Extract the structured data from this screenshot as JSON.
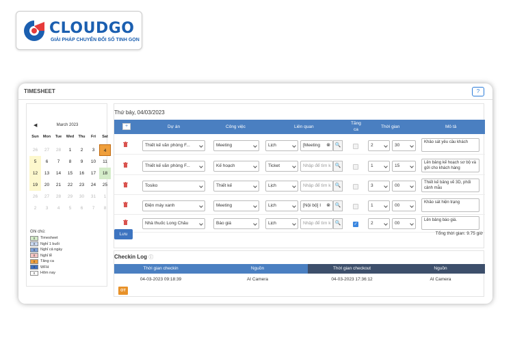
{
  "brand": {
    "name": "CLOUDGO",
    "tagline": "GIẢI PHÁP CHUYỂN ĐỔI SỐ TINH GỌN"
  },
  "header": {
    "title": "TIMESHEET",
    "help_label": "?"
  },
  "calendar": {
    "nav_prev": "◀",
    "month_label": "March 2023",
    "weekdays": [
      "Sun",
      "Mon",
      "Tue",
      "Wed",
      "Thu",
      "Fri",
      "Sat"
    ],
    "weeks": [
      [
        "26",
        "27",
        "28",
        "1",
        "2",
        "3",
        "4"
      ],
      [
        "5",
        "6",
        "7",
        "8",
        "9",
        "10",
        "11"
      ],
      [
        "12",
        "13",
        "14",
        "15",
        "16",
        "17",
        "18"
      ],
      [
        "19",
        "20",
        "21",
        "22",
        "23",
        "24",
        "25"
      ],
      [
        "26",
        "27",
        "28",
        "29",
        "30",
        "31",
        "1"
      ],
      [
        "2",
        "3",
        "4",
        "5",
        "6",
        "7",
        "8"
      ]
    ]
  },
  "legend": {
    "title": "Ghi chú:",
    "items": [
      {
        "label": "Timesheet",
        "color": "#d4ecc9",
        "mark": "x"
      },
      {
        "label": "Nghỉ 1 buổi",
        "color": "#c9d7f0",
        "mark": "x"
      },
      {
        "label": "Nghỉ cả ngày",
        "color": "#7e9fd6",
        "mark": "x"
      },
      {
        "label": "Nghỉ lễ",
        "color": "#f4c4c4",
        "mark": "x"
      },
      {
        "label": "Tăng ca",
        "color": "#ef9f3c",
        "mark": "x"
      },
      {
        "label": "WFH",
        "color": "#3c6fc0",
        "mark": "x"
      },
      {
        "label": "Hôm nay",
        "color": "#ffffff",
        "mark": "x"
      }
    ]
  },
  "timesheet": {
    "day_title": "Thứ bảy, 04/03/2023",
    "add_label": "+",
    "columns": {
      "project": "Dự án",
      "task": "Công việc",
      "related": "Liên quan",
      "overtime_1": "Tăng",
      "overtime_2": "ca",
      "time": "Thời gian",
      "description": "Mô tả"
    },
    "rows": [
      {
        "project": "Thiết kế văn phòng F...",
        "task": "Meeting",
        "rel_type": "Lịch",
        "rel_value": "[Meeting",
        "rel_filled": true,
        "clear": "⊗",
        "overtime": false,
        "hours": "2",
        "minutes": "30",
        "description": "Khảo sát yêu cầu khách"
      },
      {
        "project": "Thiết kế văn phòng F...",
        "task": "Kế hoạch",
        "rel_type": "Ticket",
        "rel_value": "Nhập để tìm k",
        "rel_filled": false,
        "clear": "",
        "overtime": false,
        "hours": "1",
        "minutes": "15",
        "description": "Lên bảng kế hoạch sơ bộ và gửi cho khách hàng"
      },
      {
        "project": "Tosiko",
        "task": "Thiết kế",
        "rel_type": "Lịch",
        "rel_value": "Nhập để tìm k",
        "rel_filled": false,
        "clear": "",
        "overtime": false,
        "hours": "3",
        "minutes": "00",
        "description": "Thiết kế bảng vẽ 3D, phối cảnh mẫu"
      },
      {
        "project": "Điện máy xanh",
        "task": "Meeting",
        "rel_type": "Lịch",
        "rel_value": "[Nội bộ] I",
        "rel_filled": true,
        "clear": "⊗",
        "overtime": false,
        "hours": "1",
        "minutes": "00",
        "description": "Khảo sát hiện trạng"
      },
      {
        "project": "Nhà thuốc Long Châu",
        "task": "Báo giá",
        "rel_type": "Lịch",
        "rel_value": "Nhập để tìm k",
        "rel_filled": false,
        "clear": "",
        "overtime": true,
        "hours": "2",
        "minutes": "00",
        "description": "Lên bảng báo giá."
      }
    ],
    "search_icon": "🔍",
    "check_mark": "✓",
    "save_label": "Lưu",
    "total_label": "Tổng thời gian: 9.75 giờ"
  },
  "checkin_log": {
    "title": "Checkin Log",
    "info_icon": "ⓘ",
    "headers": [
      "Thời gian checkin",
      "Nguồn",
      "Thời gian checkout",
      "Nguồn"
    ],
    "rows": [
      [
        "04-03-2023 09:18:39",
        "AI Camera",
        "04-03-2023 17:36:12",
        "AI Camera"
      ]
    ],
    "badge": "OT"
  },
  "colors": {
    "primary": "#4a7fc1",
    "checkout_header": "#3d4f6b",
    "overtime": "#ef9f3c",
    "brand": "#1b5fb0"
  }
}
